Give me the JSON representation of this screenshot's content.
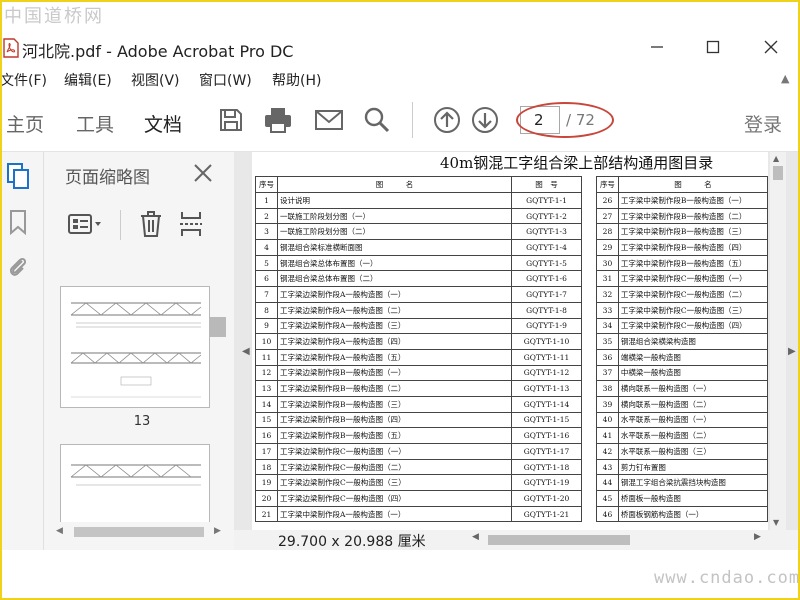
{
  "watermark_top": "中国道桥网",
  "watermark_bottom": "www.cndao.com",
  "window": {
    "title": "河北院.pdf - Adobe Acrobat Pro DC"
  },
  "menu": [
    "文件(F)",
    "编辑(E)",
    "视图(V)",
    "窗口(W)",
    "帮助(H)"
  ],
  "toolbar": {
    "tabs": [
      "主页",
      "工具",
      "文档"
    ],
    "page_current": "2",
    "page_total": "/ 72",
    "login": "登录"
  },
  "icons": [
    "save-icon",
    "print-icon",
    "mail-icon",
    "search-icon",
    "page-up-icon",
    "page-down-icon"
  ],
  "thumbnail_panel": {
    "title": "页面缩略图",
    "page_label": "13"
  },
  "document": {
    "title": "40m钢混工字组合梁上部结构通用图目录",
    "headers": {
      "no": "序号",
      "name": "图　　　名",
      "code": "图　号"
    },
    "rows_left": [
      {
        "no": "1",
        "name": "设计说明",
        "code": "GQTYT-1-1"
      },
      {
        "no": "2",
        "name": "一联施工阶段划分图（一）",
        "code": "GQTYT-1-2"
      },
      {
        "no": "3",
        "name": "一联施工阶段划分图（二）",
        "code": "GQTYT-1-3"
      },
      {
        "no": "4",
        "name": "钢混组合梁标准横断面图",
        "code": "GQTYT-1-4"
      },
      {
        "no": "5",
        "name": "钢混组合梁总体布置图（一）",
        "code": "GQTYT-1-5"
      },
      {
        "no": "6",
        "name": "钢混组合梁总体布置图（二）",
        "code": "GQTYT-1-6"
      },
      {
        "no": "7",
        "name": "工字梁边梁制作段A一般构造图（一）",
        "code": "GQTYT-1-7"
      },
      {
        "no": "8",
        "name": "工字梁边梁制作段A一般构造图（二）",
        "code": "GQTYT-1-8"
      },
      {
        "no": "9",
        "name": "工字梁边梁制作段A一般构造图（三）",
        "code": "GQTYT-1-9"
      },
      {
        "no": "10",
        "name": "工字梁边梁制作段A一般构造图（四）",
        "code": "GQTYT-1-10"
      },
      {
        "no": "11",
        "name": "工字梁边梁制作段A一般构造图（五）",
        "code": "GQTYT-1-11"
      },
      {
        "no": "12",
        "name": "工字梁边梁制作段B一般构造图（一）",
        "code": "GQTYT-1-12"
      },
      {
        "no": "13",
        "name": "工字梁边梁制作段B一般构造图（二）",
        "code": "GQTYT-1-13"
      },
      {
        "no": "14",
        "name": "工字梁边梁制作段B一般构造图（三）",
        "code": "GQTYT-1-14"
      },
      {
        "no": "15",
        "name": "工字梁边梁制作段B一般构造图（四）",
        "code": "GQTYT-1-15"
      },
      {
        "no": "16",
        "name": "工字梁边梁制作段B一般构造图（五）",
        "code": "GQTYT-1-16"
      },
      {
        "no": "17",
        "name": "工字梁边梁制作段C一般构造图（一）",
        "code": "GQTYT-1-17"
      },
      {
        "no": "18",
        "name": "工字梁边梁制作段C一般构造图（二）",
        "code": "GQTYT-1-18"
      },
      {
        "no": "19",
        "name": "工字梁边梁制作段C一般构造图（三）",
        "code": "GQTYT-1-19"
      },
      {
        "no": "20",
        "name": "工字梁边梁制作段C一般构造图（四）",
        "code": "GQTYT-1-20"
      },
      {
        "no": "21",
        "name": "工字梁中梁制作段A一般构造图（一）",
        "code": "GQTYT-1-21"
      }
    ],
    "rows_right": [
      {
        "no": "26",
        "name": "工字梁中梁制作段B一般构造图（一）"
      },
      {
        "no": "27",
        "name": "工字梁中梁制作段B一般构造图（二）"
      },
      {
        "no": "28",
        "name": "工字梁中梁制作段B一般构造图（三）"
      },
      {
        "no": "29",
        "name": "工字梁中梁制作段B一般构造图（四）"
      },
      {
        "no": "30",
        "name": "工字梁中梁制作段B一般构造图（五）"
      },
      {
        "no": "31",
        "name": "工字梁中梁制作段C一般构造图（一）"
      },
      {
        "no": "32",
        "name": "工字梁中梁制作段C一般构造图（二）"
      },
      {
        "no": "33",
        "name": "工字梁中梁制作段C一般构造图（三）"
      },
      {
        "no": "34",
        "name": "工字梁中梁制作段C一般构造图（四）"
      },
      {
        "no": "35",
        "name": "钢混组合梁横梁构造图"
      },
      {
        "no": "36",
        "name": "端横梁一般构造图"
      },
      {
        "no": "37",
        "name": "中横梁一般构造图"
      },
      {
        "no": "38",
        "name": "横向联系一般构造图（一）"
      },
      {
        "no": "39",
        "name": "横向联系一般构造图（二）"
      },
      {
        "no": "40",
        "name": "水平联系一般构造图（一）"
      },
      {
        "no": "41",
        "name": "水平联系一般构造图（二）"
      },
      {
        "no": "42",
        "name": "水平联系一般构造图（三）"
      },
      {
        "no": "43",
        "name": "剪力钉布置图"
      },
      {
        "no": "44",
        "name": "钢混工字组合梁抗震挡块构造图"
      },
      {
        "no": "45",
        "name": "桥面板一般构造图"
      },
      {
        "no": "46",
        "name": "桥面板钢筋构造图（一）"
      }
    ]
  },
  "statusbar": {
    "page_size": "29.700 x 20.988 厘米"
  }
}
